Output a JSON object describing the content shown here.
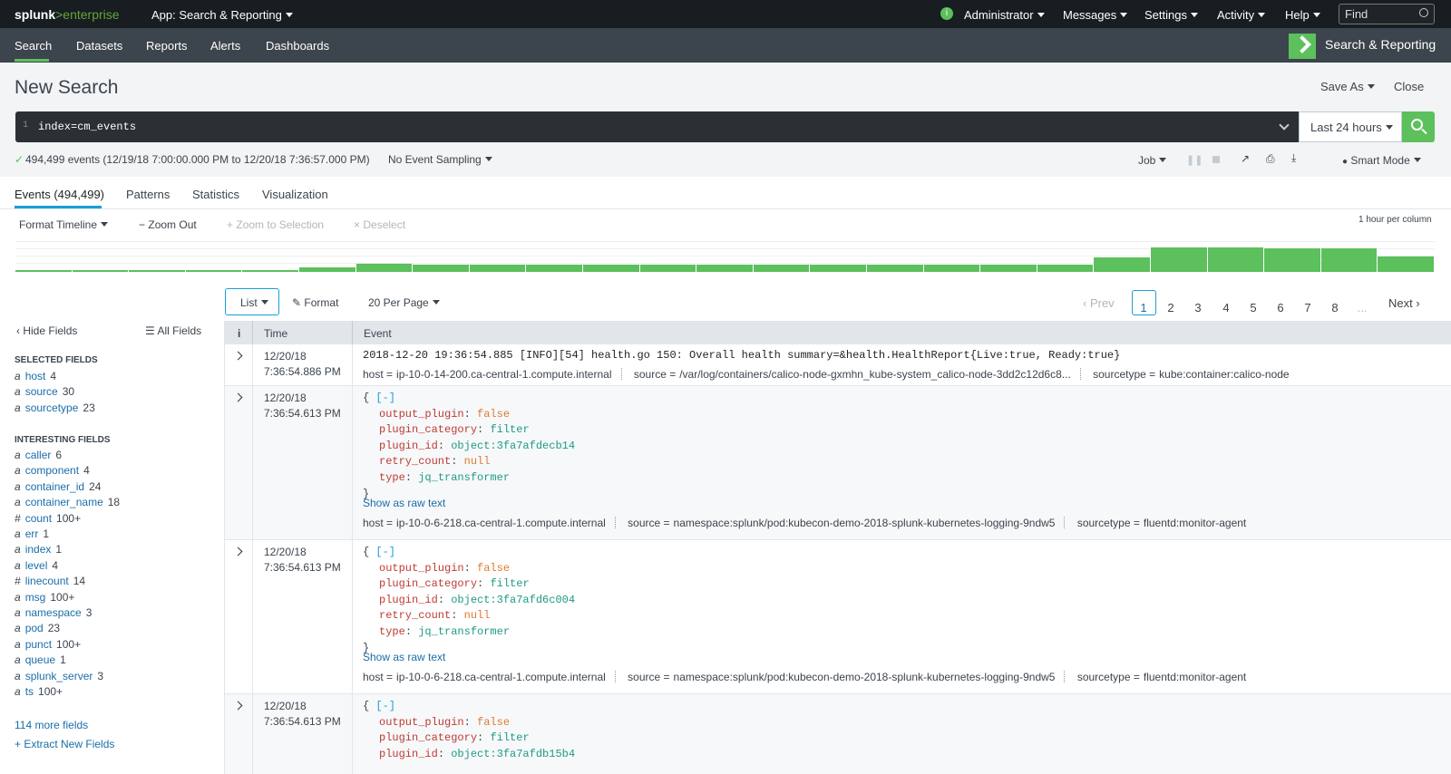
{
  "topbar": {
    "logo_left": "splunk",
    "logo_right": ">enterprise",
    "app": "App: Search & Reporting",
    "admin": "Administrator",
    "messages": "Messages",
    "settings": "Settings",
    "activity": "Activity",
    "help": "Help",
    "find_placeholder": "Find"
  },
  "nav": {
    "items": [
      "Search",
      "Datasets",
      "Reports",
      "Alerts",
      "Dashboards"
    ],
    "app_title": "Search & Reporting"
  },
  "page": {
    "title": "New Search",
    "save_as": "Save As",
    "close": "Close"
  },
  "search": {
    "line": "1",
    "query": "index=cm_events",
    "time_range": "Last 24 hours"
  },
  "status": {
    "events": "494,499 events (12/19/18 7:00:00.000 PM to 12/20/18 7:36:57.000 PM)",
    "sampling": "No Event Sampling",
    "job": "Job",
    "mode": "Smart Mode"
  },
  "tabs": [
    "Events (494,499)",
    "Patterns",
    "Statistics",
    "Visualization"
  ],
  "timeline": {
    "format": "Format Timeline",
    "zoom_out": "Zoom Out",
    "zoom_sel": "Zoom to Selection",
    "deselect": "Deselect",
    "scale": "1 hour per column",
    "bar_values": [
      2,
      2,
      2,
      2,
      2,
      5,
      9,
      8,
      8,
      8,
      8,
      8,
      8,
      8,
      8,
      8,
      8,
      8,
      8,
      16,
      27,
      27,
      26,
      26,
      17
    ]
  },
  "list_controls": {
    "list": "List",
    "format": "Format",
    "per_page": "20 Per Page",
    "prev": "Prev",
    "pages": [
      "1",
      "2",
      "3",
      "4",
      "5",
      "6",
      "7",
      "8",
      "..."
    ],
    "next": "Next"
  },
  "sidebar": {
    "hide": "Hide Fields",
    "all": "All Fields",
    "selected_title": "SELECTED FIELDS",
    "selected": [
      {
        "t": "a",
        "name": "host",
        "count": "4"
      },
      {
        "t": "a",
        "name": "source",
        "count": "30"
      },
      {
        "t": "a",
        "name": "sourcetype",
        "count": "23"
      }
    ],
    "interesting_title": "INTERESTING FIELDS",
    "interesting": [
      {
        "t": "a",
        "name": "caller",
        "count": "6"
      },
      {
        "t": "a",
        "name": "component",
        "count": "4"
      },
      {
        "t": "a",
        "name": "container_id",
        "count": "24"
      },
      {
        "t": "a",
        "name": "container_name",
        "count": "18"
      },
      {
        "t": "#",
        "name": "count",
        "count": "100+"
      },
      {
        "t": "a",
        "name": "err",
        "count": "1"
      },
      {
        "t": "a",
        "name": "index",
        "count": "1"
      },
      {
        "t": "a",
        "name": "level",
        "count": "4"
      },
      {
        "t": "#",
        "name": "linecount",
        "count": "14"
      },
      {
        "t": "a",
        "name": "msg",
        "count": "100+"
      },
      {
        "t": "a",
        "name": "namespace",
        "count": "3"
      },
      {
        "t": "a",
        "name": "pod",
        "count": "23"
      },
      {
        "t": "a",
        "name": "punct",
        "count": "100+"
      },
      {
        "t": "a",
        "name": "queue",
        "count": "1"
      },
      {
        "t": "a",
        "name": "splunk_server",
        "count": "3"
      },
      {
        "t": "a",
        "name": "ts",
        "count": "100+"
      }
    ],
    "more": "114 more fields",
    "extract": "Extract New Fields"
  },
  "table": {
    "h_info": "i",
    "h_time": "Time",
    "h_event": "Event"
  },
  "events": {
    "e1": {
      "date": "12/20/18",
      "time": "7:36:54.886 PM",
      "raw": "2018-12-20 19:36:54.885 [INFO][54] health.go 150: Overall health summary=&health.HealthReport{Live:true, Ready:true}",
      "host_k": "host =",
      "host": "ip-10-0-14-200.ca-central-1.compute.internal",
      "source_k": "source =",
      "source": "/var/log/containers/calico-node-gxmhn_kube-system_calico-node-3dd2c12d6c8...",
      "st_k": "sourcetype =",
      "st": "kube:container:calico-node"
    },
    "json_keys": {
      "open": "{",
      "collapse": "[-]",
      "close": "}",
      "k1": "output_plugin",
      "v1": "false",
      "k2": "plugin_category",
      "v2": "filter",
      "k3": "plugin_id",
      "k4": "retry_count",
      "v4": "null",
      "k5": "type",
      "v5": "jq_transformer",
      "show_raw": "Show as raw text"
    },
    "e2": {
      "date": "12/20/18",
      "time": "7:36:54.613 PM",
      "plugin_id": "object:3fa7afdecb14",
      "host_k": "host =",
      "host": "ip-10-0-6-218.ca-central-1.compute.internal",
      "source_k": "source =",
      "source": "namespace:splunk/pod:kubecon-demo-2018-splunk-kubernetes-logging-9ndw5",
      "st_k": "sourcetype =",
      "st": "fluentd:monitor-agent"
    },
    "e3": {
      "date": "12/20/18",
      "time": "7:36:54.613 PM",
      "plugin_id": "object:3fa7afd6c004",
      "host_k": "host =",
      "host": "ip-10-0-6-218.ca-central-1.compute.internal",
      "source_k": "source =",
      "source": "namespace:splunk/pod:kubecon-demo-2018-splunk-kubernetes-logging-9ndw5",
      "st_k": "sourcetype =",
      "st": "fluentd:monitor-agent"
    },
    "e4": {
      "date": "12/20/18",
      "time": "7:36:54.613 PM",
      "plugin_id": "object:3fa7afdb15b4"
    }
  }
}
